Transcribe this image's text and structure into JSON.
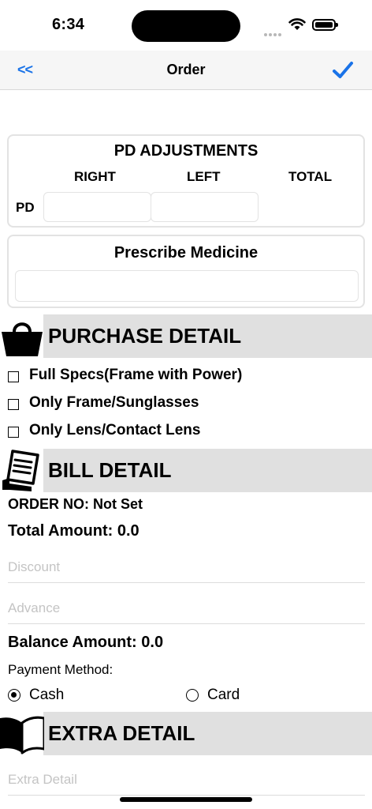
{
  "status_bar": {
    "time": "6:34"
  },
  "nav": {
    "back_label": "<<",
    "title": "Order",
    "done_icon": "checkmark-icon",
    "accent": "#1a73e8"
  },
  "pd_adjustments": {
    "title": "PD ADJUSTMENTS",
    "columns": [
      "RIGHT",
      "LEFT",
      "TOTAL"
    ],
    "row_label": "PD",
    "right_value": "",
    "left_value": ""
  },
  "prescribe": {
    "title": "Prescribe Medicine",
    "value": ""
  },
  "purchase": {
    "title": "PURCHASE DETAIL",
    "icon": "shopping-basket-icon",
    "options": [
      {
        "label": "Full Specs(Frame with Power)",
        "checked": false
      },
      {
        "label": "Only Frame/Sunglasses",
        "checked": false
      },
      {
        "label": "Only Lens/Contact Lens",
        "checked": false
      }
    ]
  },
  "bill": {
    "title": "BILL DETAIL",
    "icon": "receipt-icon",
    "order_no": "ORDER NO: Not Set",
    "total_amount": "Total Amount: 0.0",
    "discount_placeholder": "Discount",
    "advance_placeholder": "Advance",
    "balance_amount": "Balance Amount: 0.0",
    "payment_label": "Payment Method:",
    "payment_options": [
      {
        "label": "Cash",
        "selected": true
      },
      {
        "label": "Card",
        "selected": false
      }
    ]
  },
  "extra": {
    "title": "EXTRA DETAIL",
    "icon": "open-book-icon",
    "placeholder": "Extra Detail"
  }
}
